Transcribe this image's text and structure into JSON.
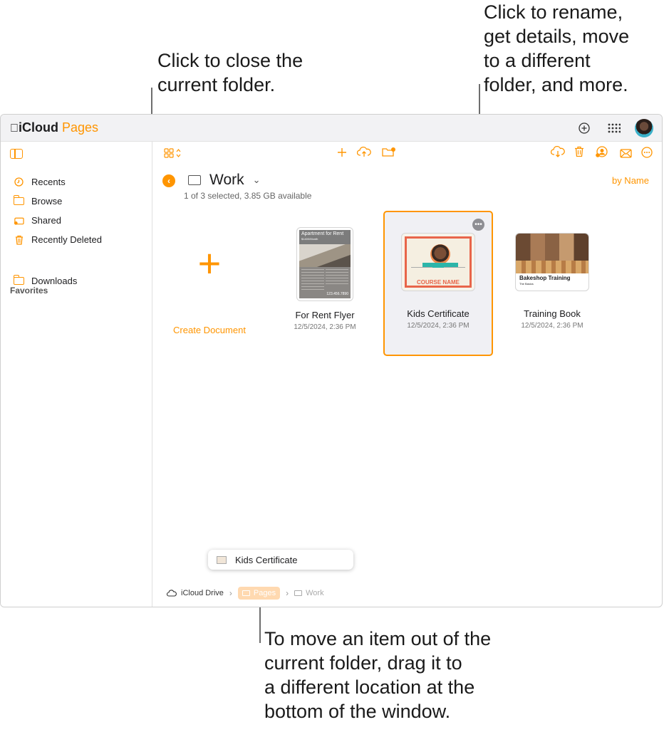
{
  "callouts": {
    "close_folder": "Click to close the\ncurrent folder.",
    "rename": "Click to rename,\nget details, move\nto a different\nfolder, and more.",
    "move": "To move an item out of the\ncurrent folder, drag it to\na different location at the\nbottom of the window."
  },
  "app": {
    "brand": "iCloud",
    "app_name": "Pages"
  },
  "topbar_icons": [
    "plus-circle-icon",
    "app-grid-icon",
    "avatar"
  ],
  "sidebar": {
    "items": [
      {
        "label": "Recents",
        "icon": "clock-icon"
      },
      {
        "label": "Browse",
        "icon": "folder-icon"
      },
      {
        "label": "Shared",
        "icon": "shared-folder-icon"
      },
      {
        "label": "Recently Deleted",
        "icon": "trash-icon"
      }
    ],
    "favorites_title": "Favorites",
    "favorites": [
      {
        "label": "Downloads",
        "icon": "folder-icon"
      }
    ]
  },
  "toolbar": {
    "left": [
      "view-grid-icon",
      "sort-chevrons-icon"
    ],
    "center": [
      "add-icon",
      "upload-icon",
      "new-folder-icon"
    ],
    "right": [
      "download-icon",
      "trash-icon",
      "share-user-icon",
      "mail-icon",
      "more-icon"
    ]
  },
  "folder": {
    "title": "Work",
    "status": "1 of 3 selected, 3.85 GB available",
    "sort": "by Name"
  },
  "create": {
    "label": "Create Document"
  },
  "documents": [
    {
      "name": "For Rent Flyer",
      "date": "12/5/2024, 2:36 PM",
      "thumb_title": "Apartment for Rent",
      "thumb_sub": "$1400/Month",
      "thumb_phone": "123.456.7890"
    },
    {
      "name": "Kids Certificate",
      "date": "12/5/2024, 2:36 PM",
      "selected": true,
      "thumb_title": "COURSE NAME"
    },
    {
      "name": "Training Book",
      "date": "12/5/2024, 2:36 PM",
      "thumb_title": "Bakeshop Training",
      "thumb_sub": "The Basics"
    }
  ],
  "drag_chip": {
    "label": "Kids Certificate"
  },
  "breadcrumb": [
    {
      "label": "iCloud Drive",
      "icon": "cloud-icon"
    },
    {
      "label": "Pages",
      "icon": "folder-icon",
      "highlighted": true
    },
    {
      "label": "Work",
      "icon": "folder-icon"
    }
  ],
  "colors": {
    "accent": "#ff9500",
    "selection_bg": "#f0f0f4",
    "certificate_border": "#e8654a",
    "certificate_ribbon": "#2cb5a9"
  }
}
